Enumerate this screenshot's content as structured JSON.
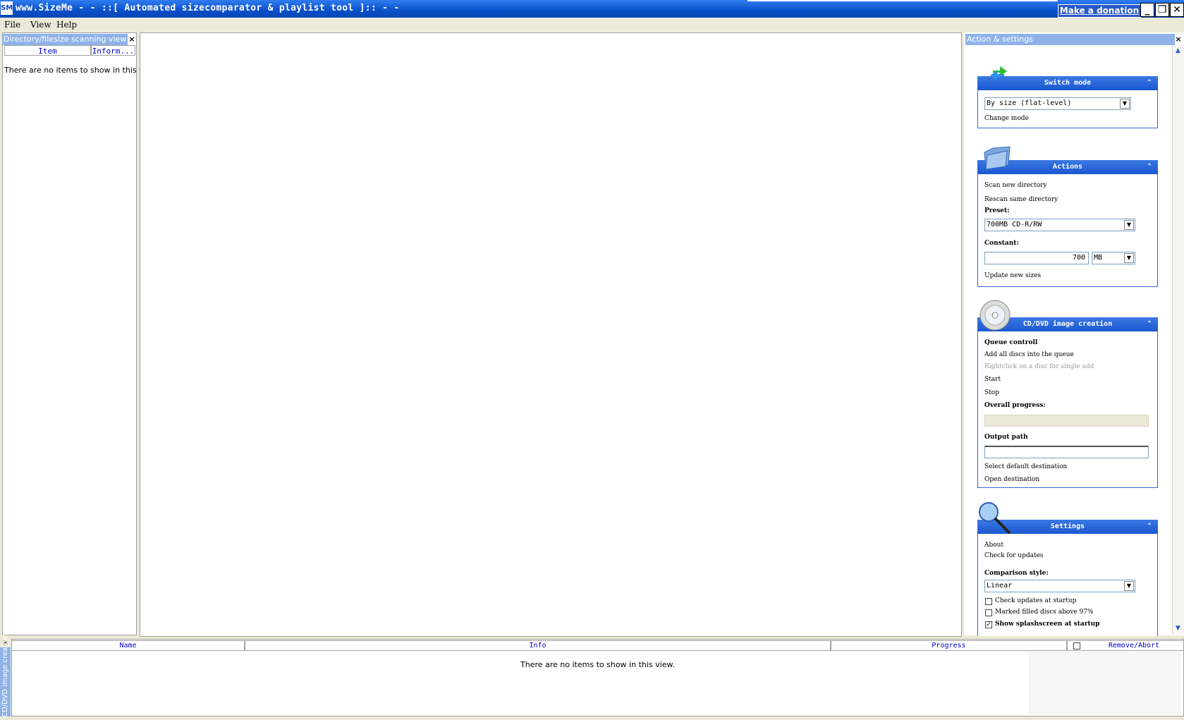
{
  "window": {
    "app_icon": "SM",
    "title": "www.SizeMe - - ::[ Automated sizecomparator & playlist tool ]:: - -",
    "donate_label": "Make a donation",
    "minimize": "_",
    "maximize": "❐",
    "close": "✕"
  },
  "menu": {
    "file": "File",
    "view": "View",
    "help": "Help"
  },
  "left_panel": {
    "caption": "Directory/filesize scanning view",
    "close": "×",
    "columns": [
      "Item",
      "Inform..."
    ],
    "empty_text": "There are no items to show in this view."
  },
  "right_panel": {
    "caption": "Action & settings",
    "close": "×",
    "scroll_up": "▲",
    "scroll_down": "▼",
    "switch_mode": {
      "title": "Switch mode",
      "selected": "By size (flat-level)",
      "change_mode": "Change mode"
    },
    "actions": {
      "title": "Actions",
      "scan": "Scan new directory",
      "rescan": "Rescan same directory",
      "preset_label": "Preset:",
      "preset_value": "700MB CD-R/RW",
      "constant_label": "Constant:",
      "constant_value": "700",
      "unit_value": "MB",
      "update": "Update new sizes"
    },
    "cd_dvd": {
      "title": "CD/DVD image creation",
      "queue_label": "Queue controll",
      "add_all": "Add all discs into the queue",
      "rightclick_hint": "Rightclick on a disc for single add",
      "start": "Start",
      "stop": "Stop",
      "overall_label": "Overall progress:",
      "output_label": "Output path",
      "select_default": "Select default destination",
      "open_destination": "Open destination"
    },
    "settings": {
      "title": "Settings",
      "about": "About",
      "check_updates": "Check for updates",
      "comparison_label": "Comparison style:",
      "comparison_value": "Linear",
      "opt_check_startup": "Check updates at startup",
      "opt_marked": "Marked filled discs above 97%",
      "opt_splash": "Show splashscreen at startup",
      "splash_checked": "✓"
    },
    "chevron": "⌃"
  },
  "bottom_panel": {
    "side_caption": "CD/DVD image creation",
    "close": "×",
    "columns": {
      "name": "Name",
      "info": "Info",
      "progress": "Progress",
      "remove": "Remove/Abort"
    },
    "empty_text": "There are no items to show in this view."
  },
  "colors": {
    "title_blue": "#0a4fc8",
    "caption_blue": "#8fb3e8",
    "group_blue": "#1e5ed8",
    "link_blue": "#0000cc"
  }
}
